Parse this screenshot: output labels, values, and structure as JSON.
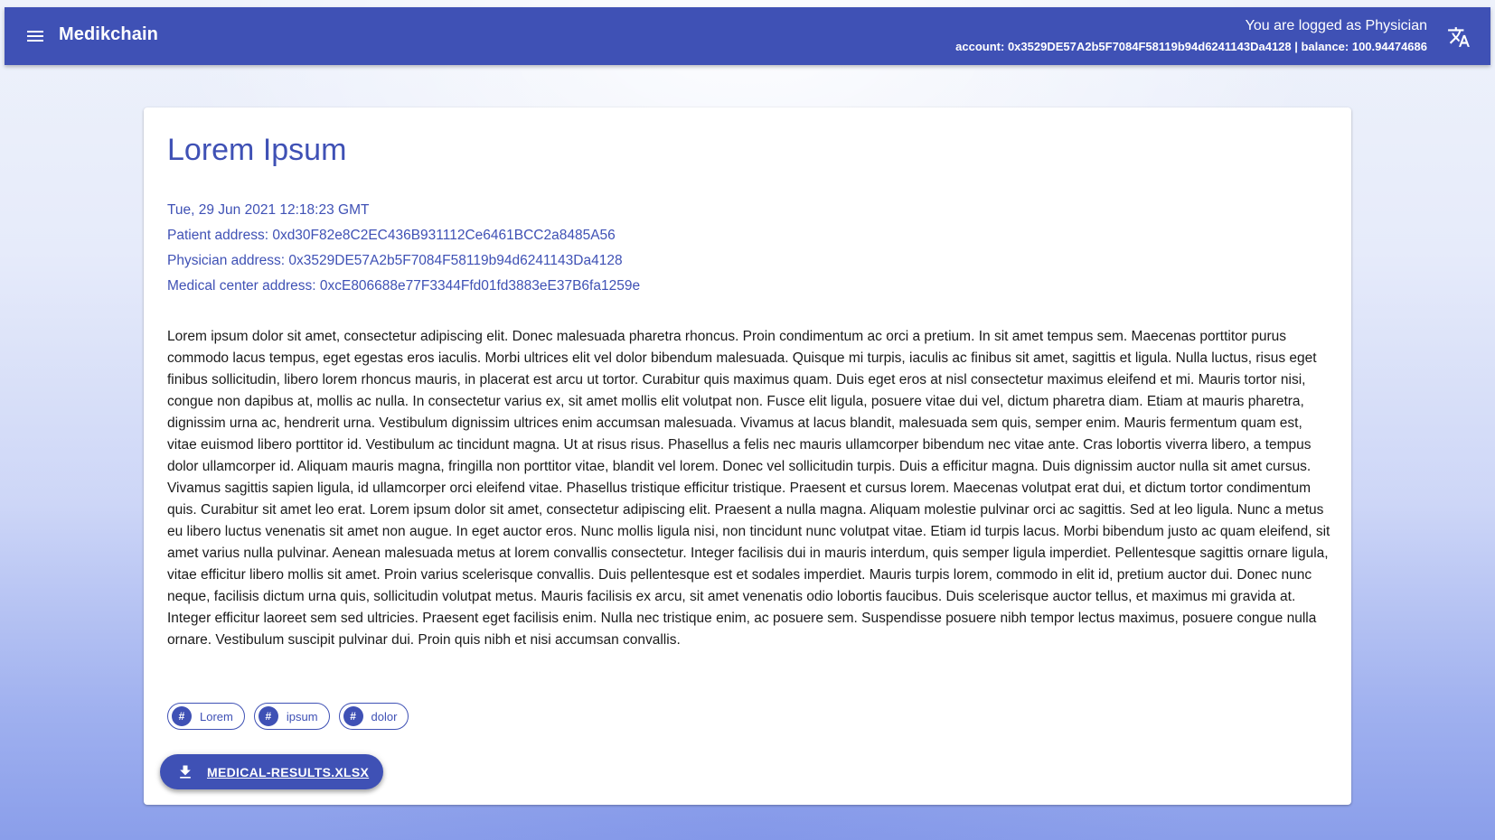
{
  "appbar": {
    "title": "Medikchain",
    "logged_as": "You are logged as Physician",
    "account_line": "account: 0x3529DE57A2b5F7084F58119b94d6241143Da4128 | balance: 100.94474686",
    "menu_icon": "menu-icon",
    "translate_icon": "translate-icon",
    "color": "#3f51b5"
  },
  "record": {
    "title": "Lorem Ipsum",
    "date": "Tue, 29 Jun 2021 12:18:23 GMT",
    "patient_address": "Patient address: 0xd30F82e8C2EC436B931112Ce6461BCC2a8485A56",
    "physician_address": "Physician address: 0x3529DE57A2b5F7084F58119b94d6241143Da4128",
    "medical_center_address": "Medical center address: 0xcE806688e77F3344Ffd01fd3883eE37B6fa1259e",
    "body": "Lorem ipsum dolor sit amet, consectetur adipiscing elit. Donec malesuada pharetra rhoncus. Proin condimentum ac orci a pretium. In sit amet tempus sem. Maecenas porttitor purus commodo lacus tempus, eget egestas eros iaculis. Morbi ultrices elit vel dolor bibendum malesuada. Quisque mi turpis, iaculis ac finibus sit amet, sagittis et ligula. Nulla luctus, risus eget finibus sollicitudin, libero lorem rhoncus mauris, in placerat est arcu ut tortor. Curabitur quis maximus quam. Duis eget eros at nisl consectetur maximus eleifend et mi. Mauris tortor nisi, congue non dapibus at, mollis ac nulla. In consectetur varius ex, sit amet mollis elit volutpat non. Fusce elit ligula, posuere vitae dui vel, dictum pharetra diam. Etiam at mauris pharetra, dignissim urna ac, hendrerit urna. Vestibulum dignissim ultrices enim accumsan malesuada. Vivamus at lacus blandit, malesuada sem quis, semper enim. Mauris fermentum quam est, vitae euismod libero porttitor id. Vestibulum ac tincidunt magna. Ut at risus risus. Phasellus a felis nec mauris ullamcorper bibendum nec vitae ante. Cras lobortis viverra libero, a tempus dolor ullamcorper id. Aliquam mauris magna, fringilla non porttitor vitae, blandit vel lorem. Donec vel sollicitudin turpis. Duis a efficitur magna. Duis dignissim auctor nulla sit amet cursus. Vivamus sagittis sapien ligula, id ullamcorper orci eleifend vitae. Phasellus tristique efficitur tristique. Praesent et cursus lorem. Maecenas volutpat erat dui, et dictum tortor condimentum quis. Curabitur sit amet leo erat. Lorem ipsum dolor sit amet, consectetur adipiscing elit. Praesent a nulla magna. Aliquam molestie pulvinar orci ac sagittis. Sed at leo ligula. Nunc a metus eu libero luctus venenatis sit amet non augue. In eget auctor eros. Nunc mollis ligula nisi, non tincidunt nunc volutpat vitae. Etiam id turpis lacus. Morbi bibendum justo ac quam eleifend, sit amet varius nulla pulvinar. Aenean malesuada metus at lorem convallis consectetur. Integer facilisis dui in mauris interdum, quis semper ligula imperdiet. Pellentesque sagittis ornare ligula, vitae efficitur libero mollis sit amet. Proin varius scelerisque convallis. Duis pellentesque est et sodales imperdiet. Mauris turpis lorem, commodo in elit id, pretium auctor dui. Donec nunc neque, facilisis dictum urna quis, sollicitudin volutpat metus. Mauris facilisis ex arcu, sit amet venenatis odio lobortis faucibus. Duis scelerisque auctor tellus, et maximus mi gravida at. Integer efficitur laoreet sem sed ultricies. Praesent eget facilisis enim. Nulla nec tristique enim, ac posuere sem. Suspendisse posuere nibh tempor lectus maximus, posuere congue nulla ornare. Vestibulum suscipit pulvinar dui. Proin quis nibh et nisi accumsan convallis.",
    "tags": [
      {
        "icon": "#",
        "label": "Lorem"
      },
      {
        "icon": "#",
        "label": "ipsum"
      },
      {
        "icon": "#",
        "label": "dolor"
      }
    ],
    "attachment": {
      "label": "MEDICAL-RESULTS.XLSX",
      "icon": "download-icon"
    }
  }
}
